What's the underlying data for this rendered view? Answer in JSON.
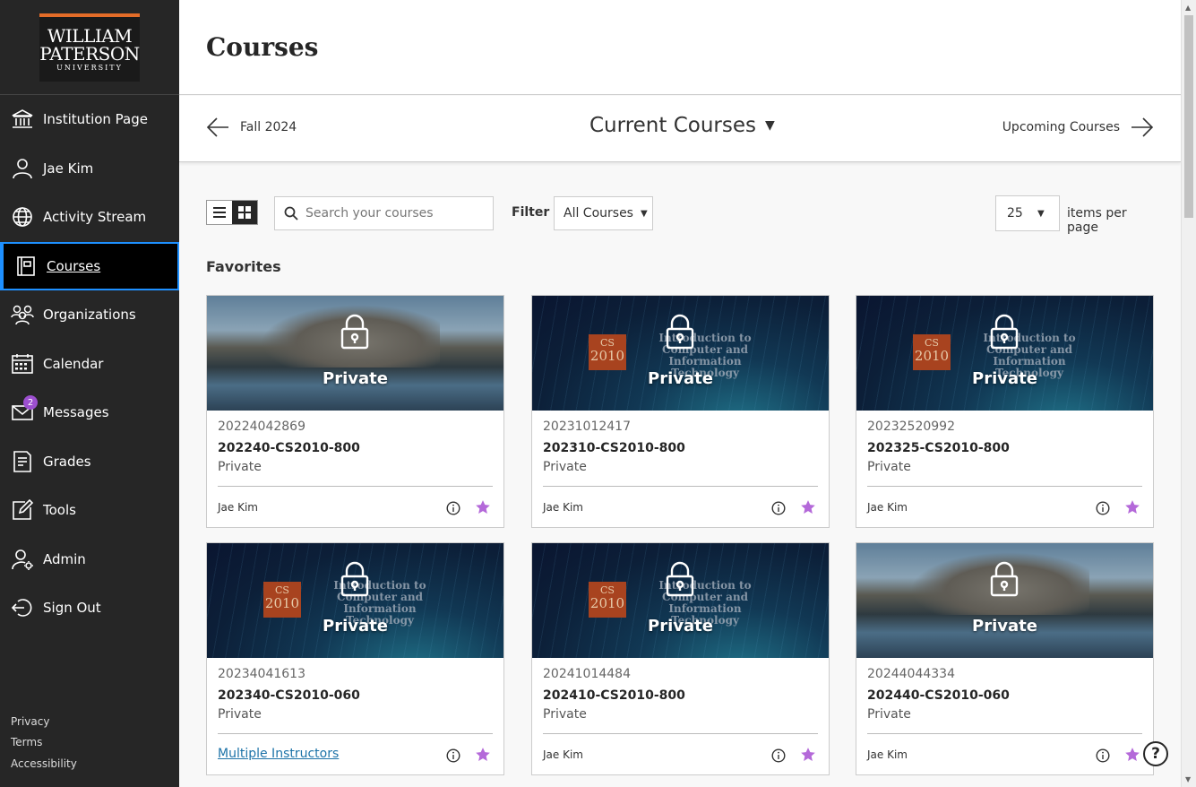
{
  "logo": {
    "line1": "WILLIAM",
    "line2": "PATERSON",
    "line3": "UNIVERSITY"
  },
  "nav": [
    {
      "label": "Institution Page",
      "icon": "institution-icon"
    },
    {
      "label": "Jae Kim",
      "icon": "user-icon"
    },
    {
      "label": "Activity Stream",
      "icon": "globe-icon"
    },
    {
      "label": "Courses",
      "icon": "courses-icon",
      "active": true
    },
    {
      "label": "Organizations",
      "icon": "organizations-icon"
    },
    {
      "label": "Calendar",
      "icon": "calendar-icon"
    },
    {
      "label": "Messages",
      "icon": "envelope-icon",
      "badge": "2"
    },
    {
      "label": "Grades",
      "icon": "grades-icon"
    },
    {
      "label": "Tools",
      "icon": "tools-icon"
    },
    {
      "label": "Admin",
      "icon": "admin-icon"
    },
    {
      "label": "Sign Out",
      "icon": "sign-out-icon"
    }
  ],
  "footer": {
    "privacy": "Privacy",
    "terms": "Terms",
    "accessibility": "Accessibility"
  },
  "page": {
    "title": "Courses"
  },
  "term": {
    "previous": "Fall 2024",
    "current": "Current Courses",
    "next": "Upcoming Courses"
  },
  "toolbar": {
    "search_placeholder": "Search your courses",
    "filter_label": "Filter",
    "filter_value": "All Courses",
    "per_page_value": "25",
    "per_page_label": "items per page"
  },
  "section": {
    "favorites": "Favorites"
  },
  "banner_text": {
    "cs": "CS",
    "num": "2010",
    "line1": "Introduction to",
    "line2": "Computer and",
    "line3": "Information Technology"
  },
  "courses": [
    {
      "id": "20224042869",
      "code": "202240-CS2010-800",
      "status": "Private",
      "banner_label": "Private",
      "instructor": "Jae Kim",
      "banner": "rock"
    },
    {
      "id": "20231012417",
      "code": "202310-CS2010-800",
      "status": "Private",
      "banner_label": "Private",
      "instructor": "Jae Kim",
      "banner": "tech"
    },
    {
      "id": "20232520992",
      "code": "202325-CS2010-800",
      "status": "Private",
      "banner_label": "Private",
      "instructor": "Jae Kim",
      "banner": "tech"
    },
    {
      "id": "20234041613",
      "code": "202340-CS2010-060",
      "status": "Private",
      "banner_label": "Private",
      "instructor": "Multiple Instructors",
      "banner": "tech"
    },
    {
      "id": "20241014484",
      "code": "202410-CS2010-800",
      "status": "Private",
      "banner_label": "Private",
      "instructor": "Jae Kim",
      "banner": "tech"
    },
    {
      "id": "20244044334",
      "code": "202440-CS2010-060",
      "status": "Private",
      "banner_label": "Private",
      "instructor": "Jae Kim",
      "banner": "rock"
    }
  ],
  "colors": {
    "sidebar": "#262626",
    "accent": "#1e90ff",
    "star": "#b469d9",
    "badge": "#9c4fcf",
    "link": "#1d73a8"
  }
}
